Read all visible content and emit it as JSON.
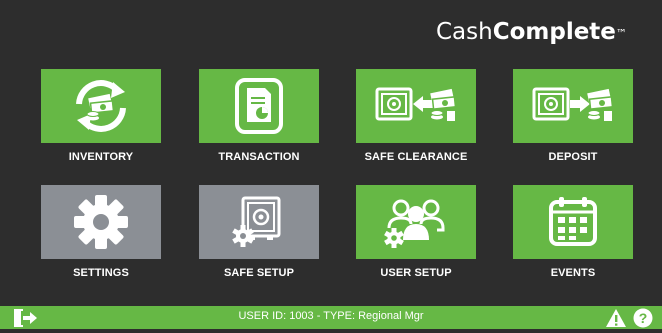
{
  "brand": {
    "prefix": "Cash",
    "bold": "Complete",
    "trademark": "™"
  },
  "tiles": [
    {
      "label": "INVENTORY",
      "icon": "inventory-cycle-icon",
      "color": "#66b845"
    },
    {
      "label": "TRANSACTION",
      "icon": "document-icon",
      "color": "#66b845"
    },
    {
      "label": "SAFE CLEARANCE",
      "icon": "safe-clearance-icon",
      "color": "#66b845"
    },
    {
      "label": "DEPOSIT",
      "icon": "deposit-icon",
      "color": "#66b845"
    },
    {
      "label": "SETTINGS",
      "icon": "gear-icon",
      "color": "#8b8f95"
    },
    {
      "label": "SAFE SETUP",
      "icon": "safe-gear-icon",
      "color": "#8b8f95"
    },
    {
      "label": "USER SETUP",
      "icon": "users-gear-icon",
      "color": "#66b845"
    },
    {
      "label": "EVENTS",
      "icon": "calendar-icon",
      "color": "#66b845"
    }
  ],
  "status": {
    "text": "USER ID: 1003  - TYPE: Regional Mgr",
    "icons": [
      "exit-icon",
      "warning-icon",
      "help-icon"
    ]
  },
  "colors": {
    "background": "#2d2d2d",
    "accent": "#66b845",
    "disabled": "#8b8f95",
    "text": "#ffffff"
  }
}
